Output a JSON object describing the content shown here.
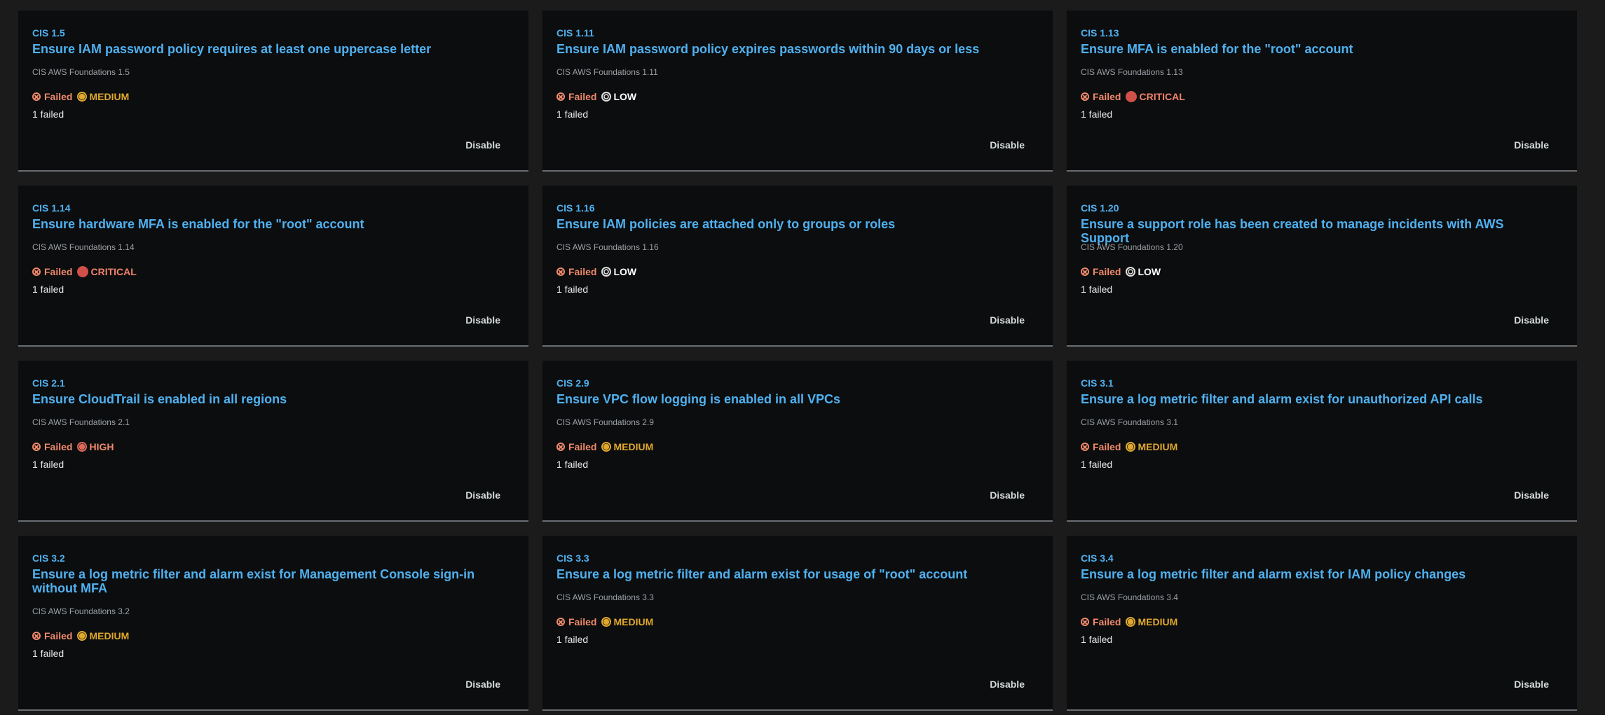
{
  "status_label": "Failed",
  "disable_label": "Disable",
  "cards": [
    {
      "id": "CIS 1.5",
      "title": "Ensure IAM password policy requires at least one uppercase letter",
      "standard": "CIS AWS Foundations 1.5",
      "severity": "MEDIUM",
      "count": "1 failed"
    },
    {
      "id": "CIS 1.11",
      "title": "Ensure IAM password policy expires passwords within 90 days or less",
      "standard": "CIS AWS Foundations 1.11",
      "severity": "LOW",
      "count": "1 failed"
    },
    {
      "id": "CIS 1.13",
      "title": "Ensure MFA is enabled for the \"root\" account",
      "standard": "CIS AWS Foundations 1.13",
      "severity": "CRITICAL",
      "count": "1 failed"
    },
    {
      "id": "CIS 1.14",
      "title": "Ensure hardware MFA is enabled for the \"root\" account",
      "standard": "CIS AWS Foundations 1.14",
      "severity": "CRITICAL",
      "count": "1 failed"
    },
    {
      "id": "CIS 1.16",
      "title": "Ensure IAM policies are attached only to groups or roles",
      "standard": "CIS AWS Foundations 1.16",
      "severity": "LOW",
      "count": "1 failed"
    },
    {
      "id": "CIS 1.20",
      "title": "Ensure a support role has been created to manage incidents with AWS Support",
      "standard": "CIS AWS Foundations 1.20",
      "severity": "LOW",
      "count": "1 failed"
    },
    {
      "id": "CIS 2.1",
      "title": "Ensure CloudTrail is enabled in all regions",
      "standard": "CIS AWS Foundations 2.1",
      "severity": "HIGH",
      "count": "1 failed"
    },
    {
      "id": "CIS 2.9",
      "title": "Ensure VPC flow logging is enabled in all VPCs",
      "standard": "CIS AWS Foundations 2.9",
      "severity": "MEDIUM",
      "count": "1 failed"
    },
    {
      "id": "CIS 3.1",
      "title": "Ensure a log metric filter and alarm exist for unauthorized API calls",
      "standard": "CIS AWS Foundations 3.1",
      "severity": "MEDIUM",
      "count": "1 failed"
    },
    {
      "id": "CIS 3.2",
      "title": "Ensure a log metric filter and alarm exist for Management Console sign-in without MFA",
      "standard": "CIS AWS Foundations 3.2",
      "severity": "MEDIUM",
      "count": "1 failed"
    },
    {
      "id": "CIS 3.3",
      "title": "Ensure a log metric filter and alarm exist for usage of \"root\" account",
      "standard": "CIS AWS Foundations 3.3",
      "severity": "MEDIUM",
      "count": "1 failed"
    },
    {
      "id": "CIS 3.4",
      "title": "Ensure a log metric filter and alarm exist for IAM policy changes",
      "standard": "CIS AWS Foundations 3.4",
      "severity": "MEDIUM",
      "count": "1 failed"
    }
  ],
  "colors": {
    "link": "#4fb1f0",
    "failed": "#f08a6c",
    "medium": "#e0a82e",
    "critical": "#d0504a",
    "low": "#ffffff",
    "card_bg": "#0c0d0e",
    "page_bg": "#1b1b1b"
  }
}
